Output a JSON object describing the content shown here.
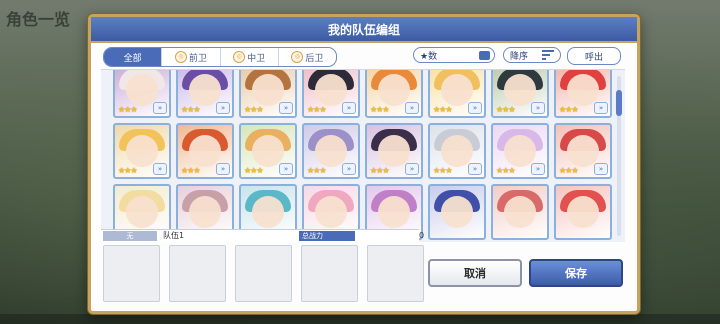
{
  "background": {
    "title": "角色一览"
  },
  "dialog": {
    "title": "我的队伍编组"
  },
  "filter_tabs": [
    {
      "label": "全部",
      "icon": ""
    },
    {
      "label": "前卫",
      "icon": "target-icon"
    },
    {
      "label": "中卫",
      "icon": "target-icon"
    },
    {
      "label": "后卫",
      "icon": "target-icon"
    }
  ],
  "sort": {
    "star_label": "★数",
    "order_label": "降序",
    "call_label": "呼出"
  },
  "cards": [
    {
      "stars": "★★★",
      "hair": "#f1e7e7",
      "frame": "#c9a7d6"
    },
    {
      "stars": "★★★",
      "hair": "#6a4ea6",
      "frame": "#c8b6e8"
    },
    {
      "stars": "★★★",
      "hair": "#b4743f",
      "frame": "#e8c7a2"
    },
    {
      "stars": "★★★",
      "hair": "#2d2a3a",
      "frame": "#f0b8c2"
    },
    {
      "stars": "★★★",
      "hair": "#e88a3a",
      "frame": "#f4d2a0"
    },
    {
      "stars": "★★★",
      "hair": "#f0c060",
      "frame": "#f6dfa0"
    },
    {
      "stars": "★★★",
      "hair": "#2f3a3f",
      "frame": "#b8c8a8"
    },
    {
      "stars": "★★★",
      "hair": "#e0403f",
      "frame": "#f2b0a8"
    },
    {
      "stars": "★★★",
      "hair": "#f2c35a",
      "frame": "#f0d8a8"
    },
    {
      "stars": "★★★",
      "hair": "#d85a2e",
      "frame": "#f0b890"
    },
    {
      "stars": "★★★",
      "hair": "#e8b060",
      "frame": "#d6e6b8"
    },
    {
      "stars": "★★★",
      "hair": "#9c90c8",
      "frame": "#d0cae8"
    },
    {
      "stars": "★★★",
      "hair": "#3a2e4a",
      "frame": "#d8c0e0"
    },
    {
      "stars": "★★★",
      "hair": "#c9ccd6",
      "frame": "#dde2ea"
    },
    {
      "stars": "★★★",
      "hair": "#d8b8e8",
      "frame": "#ecd8f2"
    },
    {
      "stars": "★★★",
      "hair": "#d84a4a",
      "frame": "#f4c0b8"
    },
    {
      "stars": "",
      "hair": "#f2dca0",
      "frame": "#f4ead0"
    },
    {
      "stars": "",
      "hair": "#c8a0a8",
      "frame": "#e8d0d8"
    },
    {
      "stars": "",
      "hair": "#5ab8c8",
      "frame": "#c8e4ea"
    },
    {
      "stars": "",
      "hair": "#f0a8c0",
      "frame": "#f8d8e4"
    },
    {
      "stars": "",
      "hair": "#c080c8",
      "frame": "#e4c8ea"
    },
    {
      "stars": "",
      "hair": "#4050a8",
      "frame": "#c8ccec"
    },
    {
      "stars": "",
      "hair": "#d86a6a",
      "frame": "#f2ccc8"
    },
    {
      "stars": "",
      "hair": "#e25050",
      "frame": "#f4c4c0"
    }
  ],
  "team_bar": {
    "label": "无",
    "team_name": "队伍1",
    "power_label": "总战力",
    "power_value": "0"
  },
  "buttons": {
    "cancel": "取消",
    "save": "保存"
  }
}
